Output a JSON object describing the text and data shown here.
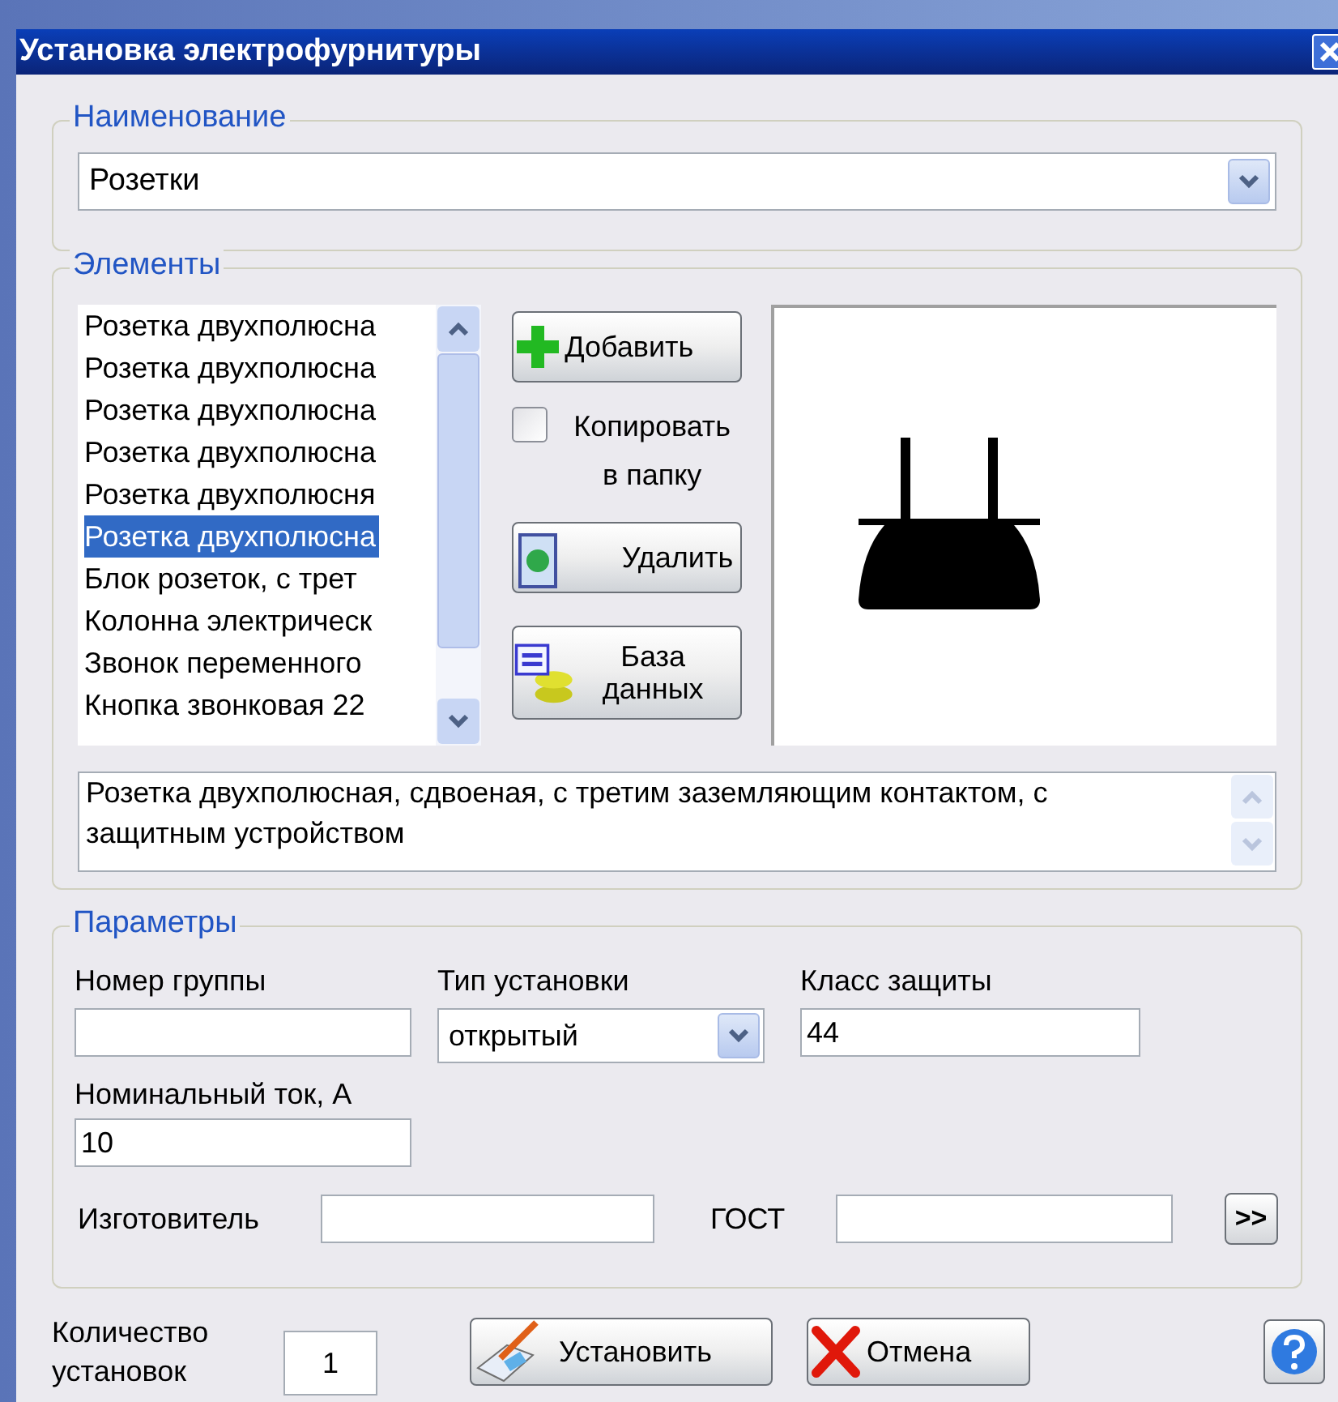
{
  "window": {
    "title": "Установка электрофурнитуры"
  },
  "name_group": {
    "title": "Наименование",
    "value": "Розетки"
  },
  "elements_group": {
    "title": "Элементы",
    "items": [
      {
        "label": "Розетка двухполюсна",
        "selected": false
      },
      {
        "label": "Розетка двухполюсна",
        "selected": false
      },
      {
        "label": "Розетка двухполюсна",
        "selected": false
      },
      {
        "label": "Розетка двухполюсна",
        "selected": false
      },
      {
        "label": "Розетка двухполюсня",
        "selected": false
      },
      {
        "label": "Розетка двухполюсна",
        "selected": true
      },
      {
        "label": "Блок розеток, с трет",
        "selected": false
      },
      {
        "label": "Колонна электрическ",
        "selected": false
      },
      {
        "label": "Звонок переменного",
        "selected": false
      },
      {
        "label": "Кнопка звонковая 22",
        "selected": false
      }
    ],
    "add_button": "Добавить",
    "copy_checkbox": {
      "label": "Копировать в папку",
      "checked": false
    },
    "delete_button": "Удалить",
    "database_button": "База данных",
    "description": "Розетка двухполюсная, сдвоеная, с третим заземляющим контактом, с защитным устройством"
  },
  "params_group": {
    "title": "Параметры",
    "group_number": {
      "label": "Номер группы"
    },
    "install_type": {
      "label": "Тип установки",
      "value": "открытый"
    },
    "protection_class": {
      "label": "Класс защиты",
      "value": "44"
    },
    "rated_current": {
      "label": "Номинальный ток, А",
      "value": "10"
    },
    "manufacturer": {
      "label": "Изготовитель"
    },
    "gost": {
      "label": "ГОСТ"
    },
    "more_button": ">>"
  },
  "quantity": {
    "label": "Количество установок",
    "value": "1"
  },
  "install_button": "Установить",
  "cancel_button": "Отмена"
}
